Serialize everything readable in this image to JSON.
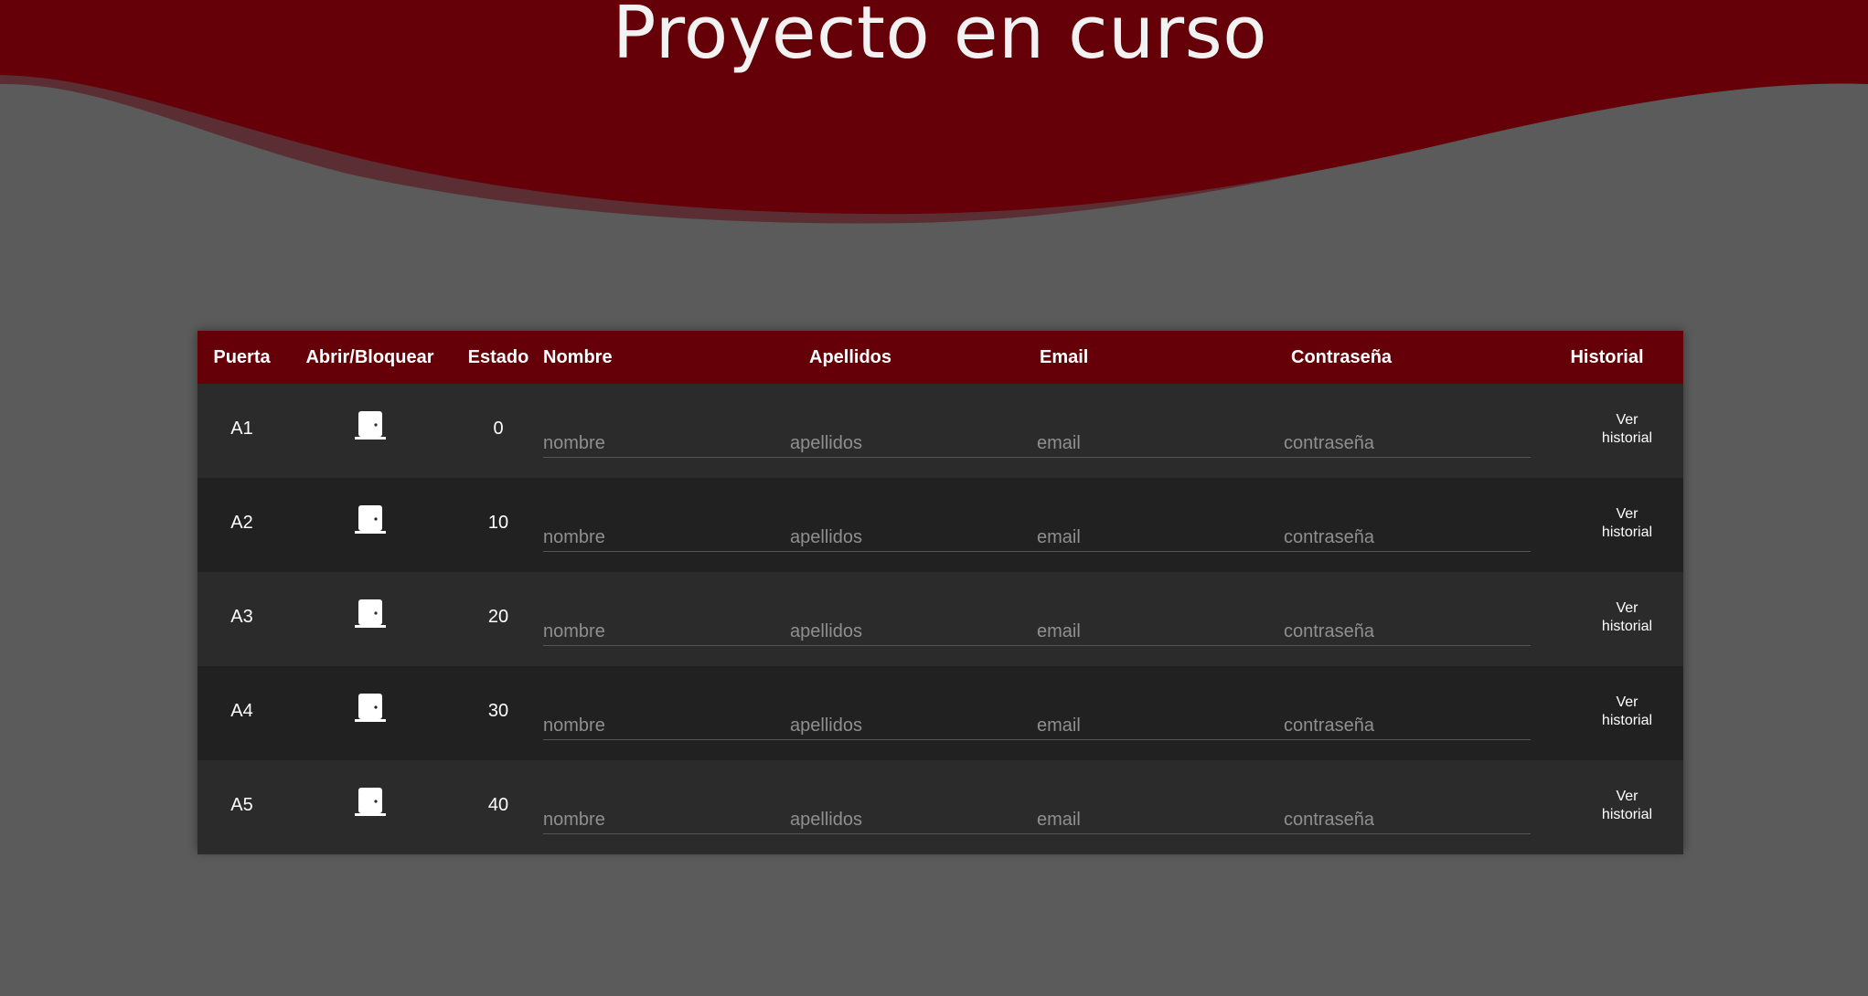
{
  "page": {
    "title": "Proyecto en curso"
  },
  "colors": {
    "header_red": "#650008",
    "background": "#5b5b5b",
    "row_light": "#2b2b2b",
    "row_dark": "#212121"
  },
  "table": {
    "headers": {
      "puerta": "Puerta",
      "abrir": "Abrir/Bloquear",
      "estado": "Estado",
      "nombre": "Nombre",
      "apellidos": "Apellidos",
      "email": "Email",
      "contrasena": "Contraseña",
      "historial": "Historial"
    },
    "rows": [
      {
        "puerta": "A1",
        "door_icon": "door-icon",
        "estado": "0",
        "nombre_placeholder": "nombre",
        "apellidos_placeholder": "apellidos",
        "email_placeholder": "email",
        "contrasena_placeholder": "contraseña",
        "historial_label": "Ver historial"
      },
      {
        "puerta": "A2",
        "door_icon": "door-icon",
        "estado": "10",
        "nombre_placeholder": "nombre",
        "apellidos_placeholder": "apellidos",
        "email_placeholder": "email",
        "contrasena_placeholder": "contraseña",
        "historial_label": "Ver historial"
      },
      {
        "puerta": "A3",
        "door_icon": "door-icon",
        "estado": "20",
        "nombre_placeholder": "nombre",
        "apellidos_placeholder": "apellidos",
        "email_placeholder": "email",
        "contrasena_placeholder": "contraseña",
        "historial_label": "Ver historial"
      },
      {
        "puerta": "A4",
        "door_icon": "door-icon",
        "estado": "30",
        "nombre_placeholder": "nombre",
        "apellidos_placeholder": "apellidos",
        "email_placeholder": "email",
        "contrasena_placeholder": "contraseña",
        "historial_label": "Ver historial"
      },
      {
        "puerta": "A5",
        "door_icon": "door-icon",
        "estado": "40",
        "nombre_placeholder": "nombre",
        "apellidos_placeholder": "apellidos",
        "email_placeholder": "email",
        "contrasena_placeholder": "contraseña",
        "historial_label": "Ver historial"
      }
    ]
  }
}
